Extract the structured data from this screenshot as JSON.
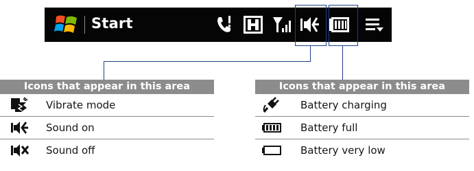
{
  "titlebar": {
    "start_label": "Start",
    "icons": [
      "windows-logo-icon",
      "phone-call-icon",
      "h-network-icon",
      "signal-strength-icon",
      "sound-on-icon",
      "battery-full-icon",
      "menu-dropdown-icon"
    ]
  },
  "left_table": {
    "heading": "Icons that appear in this area",
    "rows": [
      {
        "icon": "vibrate-mode-icon",
        "label": "Vibrate mode"
      },
      {
        "icon": "sound-on-icon",
        "label": "Sound on"
      },
      {
        "icon": "sound-off-icon",
        "label": "Sound off"
      }
    ]
  },
  "right_table": {
    "heading": "Icons that appear in this area",
    "rows": [
      {
        "icon": "battery-charging-icon",
        "label": "Battery charging"
      },
      {
        "icon": "battery-full-icon",
        "label": "Battery full"
      },
      {
        "icon": "battery-very-low-icon",
        "label": "Battery very low"
      }
    ]
  },
  "colors": {
    "titlebar_bg": "#050505",
    "callout_line": "#1f3f8a",
    "table_header_bg": "#8c8c8c"
  }
}
